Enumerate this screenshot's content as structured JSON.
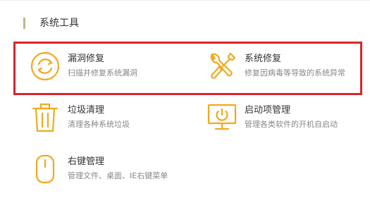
{
  "section": {
    "title": "系统工具"
  },
  "tools": [
    {
      "name": "漏洞修复",
      "desc": "扫描并修复系统漏洞",
      "icon": "refresh-circle-icon"
    },
    {
      "name": "系统修复",
      "desc": "修复因病毒等导致的系统异常",
      "icon": "wrench-screwdriver-icon"
    },
    {
      "name": "垃圾清理",
      "desc": "清理各种系统垃圾",
      "icon": "trash-bin-icon"
    },
    {
      "name": "启动项管理",
      "desc": "管理各类软件的开机自启动",
      "icon": "monitor-power-icon"
    },
    {
      "name": "右键管理",
      "desc": "管理文件、桌面、IE右键菜单",
      "icon": "mouse-icon"
    }
  ],
  "colors": {
    "icon": "#f2a81d",
    "highlight": "#d9252b",
    "section_bar": "#c9b48a"
  }
}
